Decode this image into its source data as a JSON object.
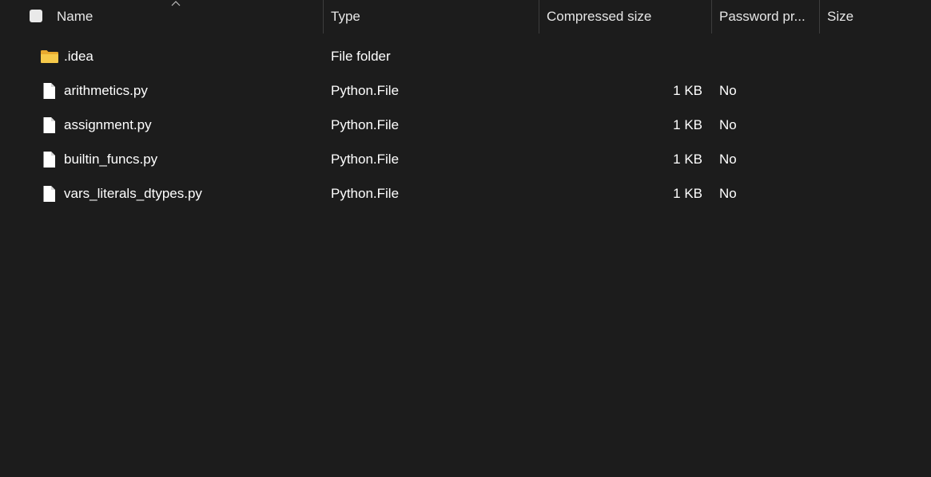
{
  "columns": {
    "name": "Name",
    "type": "Type",
    "compressed_size": "Compressed size",
    "password": "Password pr...",
    "size": "Size"
  },
  "files": [
    {
      "name": ".idea",
      "type": "File folder",
      "compressed_size": "",
      "password": "",
      "size": "",
      "icon": "folder-icon"
    },
    {
      "name": "arithmetics.py",
      "type": "Python.File",
      "compressed_size": "1 KB",
      "password": "No",
      "size": "",
      "icon": "file-icon"
    },
    {
      "name": "assignment.py",
      "type": "Python.File",
      "compressed_size": "1 KB",
      "password": "No",
      "size": "",
      "icon": "file-icon"
    },
    {
      "name": "builtin_funcs.py",
      "type": "Python.File",
      "compressed_size": "1 KB",
      "password": "No",
      "size": "",
      "icon": "file-icon"
    },
    {
      "name": "vars_literals_dtypes.py",
      "type": "Python.File",
      "compressed_size": "1 KB",
      "password": "No",
      "size": "",
      "icon": "file-icon"
    }
  ],
  "colors": {
    "background": "#1c1c1c",
    "text": "#ffffff",
    "folder": "#f4c443"
  }
}
